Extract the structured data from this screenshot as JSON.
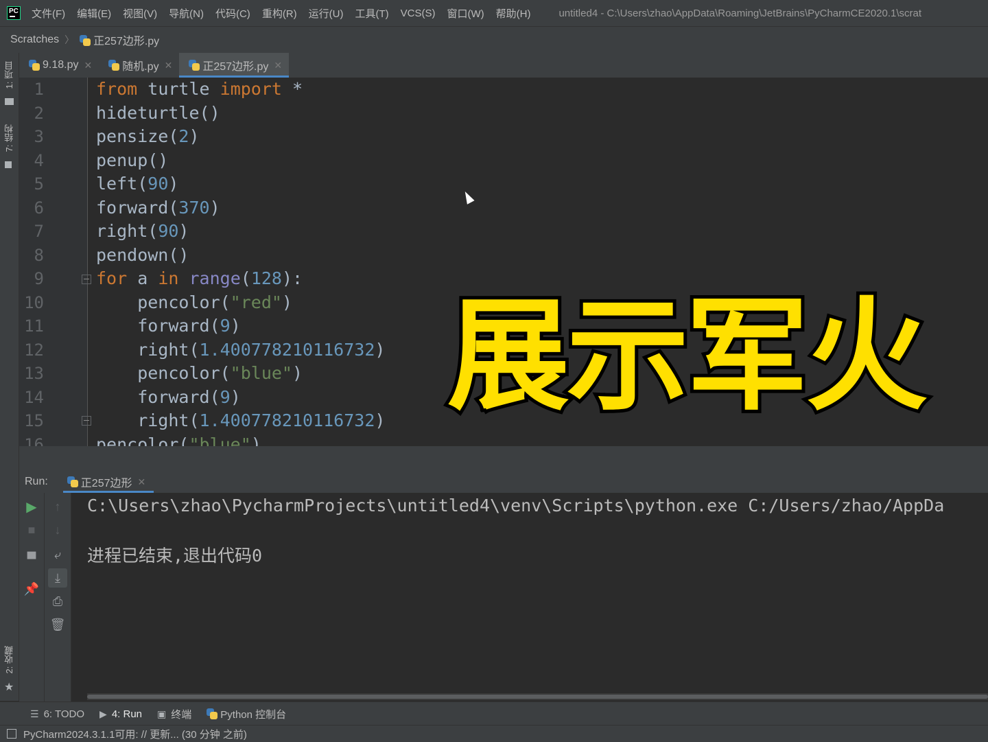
{
  "menubar": {
    "logo": "PC",
    "items": [
      "文件(F)",
      "编辑(E)",
      "视图(V)",
      "导航(N)",
      "代码(C)",
      "重构(R)",
      "运行(U)",
      "工具(T)",
      "VCS(S)",
      "窗口(W)",
      "帮助(H)"
    ],
    "window_title": "untitled4 - C:\\Users\\zhao\\AppData\\Roaming\\JetBrains\\PyCharmCE2020.1\\scrat"
  },
  "breadcrumb": {
    "root": "Scratches",
    "file": "正257边形.py"
  },
  "left_strip": {
    "project": "1: 项目",
    "structure": "7: 结构",
    "favorites": "2: 收藏"
  },
  "tabs": [
    {
      "label": "9.18.py"
    },
    {
      "label": "随机.py"
    },
    {
      "label": "正257边形.py"
    }
  ],
  "editor": {
    "line_numbers": [
      "1",
      "2",
      "3",
      "4",
      "5",
      "6",
      "7",
      "8",
      "9",
      "10",
      "11",
      "12",
      "13",
      "14",
      "15",
      "16"
    ],
    "lines": [
      [
        {
          "t": "from",
          "c": "kw"
        },
        {
          "t": " turtle ",
          "c": ""
        },
        {
          "t": "import",
          "c": "kw"
        },
        {
          "t": " *",
          "c": ""
        }
      ],
      [
        {
          "t": "hideturtle()",
          "c": ""
        }
      ],
      [
        {
          "t": "pensize(",
          "c": ""
        },
        {
          "t": "2",
          "c": "num"
        },
        {
          "t": ")",
          "c": ""
        }
      ],
      [
        {
          "t": "penup()",
          "c": ""
        }
      ],
      [
        {
          "t": "left(",
          "c": ""
        },
        {
          "t": "90",
          "c": "num"
        },
        {
          "t": ")",
          "c": ""
        }
      ],
      [
        {
          "t": "forward(",
          "c": ""
        },
        {
          "t": "370",
          "c": "num"
        },
        {
          "t": ")",
          "c": ""
        }
      ],
      [
        {
          "t": "right(",
          "c": ""
        },
        {
          "t": "90",
          "c": "num"
        },
        {
          "t": ")",
          "c": ""
        }
      ],
      [
        {
          "t": "pendown()",
          "c": ""
        }
      ],
      [
        {
          "t": "for",
          "c": "kw"
        },
        {
          "t": " a ",
          "c": ""
        },
        {
          "t": "in",
          "c": "kw"
        },
        {
          "t": " ",
          "c": ""
        },
        {
          "t": "range",
          "c": "bi"
        },
        {
          "t": "(",
          "c": ""
        },
        {
          "t": "128",
          "c": "num"
        },
        {
          "t": "):",
          "c": ""
        }
      ],
      [
        {
          "t": "    pencolor(",
          "c": ""
        },
        {
          "t": "\"red\"",
          "c": "str"
        },
        {
          "t": ")",
          "c": ""
        }
      ],
      [
        {
          "t": "    forward(",
          "c": ""
        },
        {
          "t": "9",
          "c": "num"
        },
        {
          "t": ")",
          "c": ""
        }
      ],
      [
        {
          "t": "    right(",
          "c": ""
        },
        {
          "t": "1.400778210116732",
          "c": "num"
        },
        {
          "t": ")",
          "c": ""
        }
      ],
      [
        {
          "t": "    pencolor(",
          "c": ""
        },
        {
          "t": "\"blue\"",
          "c": "str"
        },
        {
          "t": ")",
          "c": ""
        }
      ],
      [
        {
          "t": "    forward(",
          "c": ""
        },
        {
          "t": "9",
          "c": "num"
        },
        {
          "t": ")",
          "c": ""
        }
      ],
      [
        {
          "t": "    right(",
          "c": ""
        },
        {
          "t": "1.400778210116732",
          "c": "num"
        },
        {
          "t": ")",
          "c": ""
        }
      ],
      [
        {
          "t": "pencolor(",
          "c": ""
        },
        {
          "t": "\"blue\"",
          "c": "str"
        },
        {
          "t": ")",
          "c": ""
        }
      ]
    ]
  },
  "overlay_caption": "展示军火",
  "run_panel": {
    "label": "Run:",
    "tab": "正257边形",
    "console_lines": [
      "C:\\Users\\zhao\\PycharmProjects\\untitled4\\venv\\Scripts\\python.exe C:/Users/zhao/AppDa",
      "进程已结束,退出代码0"
    ]
  },
  "toolwindows": [
    {
      "label": "6: TODO",
      "icon": "list-icon"
    },
    {
      "label": "4: Run",
      "icon": "run-icon"
    },
    {
      "label": "终端",
      "icon": "terminal-icon"
    },
    {
      "label": "Python 控制台",
      "icon": "python-icon"
    }
  ],
  "status": {
    "text": "PyCharm2024.3.1.1可用: // 更新... (30 分钟 之前)"
  },
  "colors": {
    "background": "#2b2b2b",
    "chrome": "#3c3f41",
    "keyword": "#cc7832",
    "number": "#6897bb",
    "string": "#6a8759",
    "builtin": "#8888c6",
    "caption": "#ffe000",
    "accent": "#4a88c7"
  }
}
